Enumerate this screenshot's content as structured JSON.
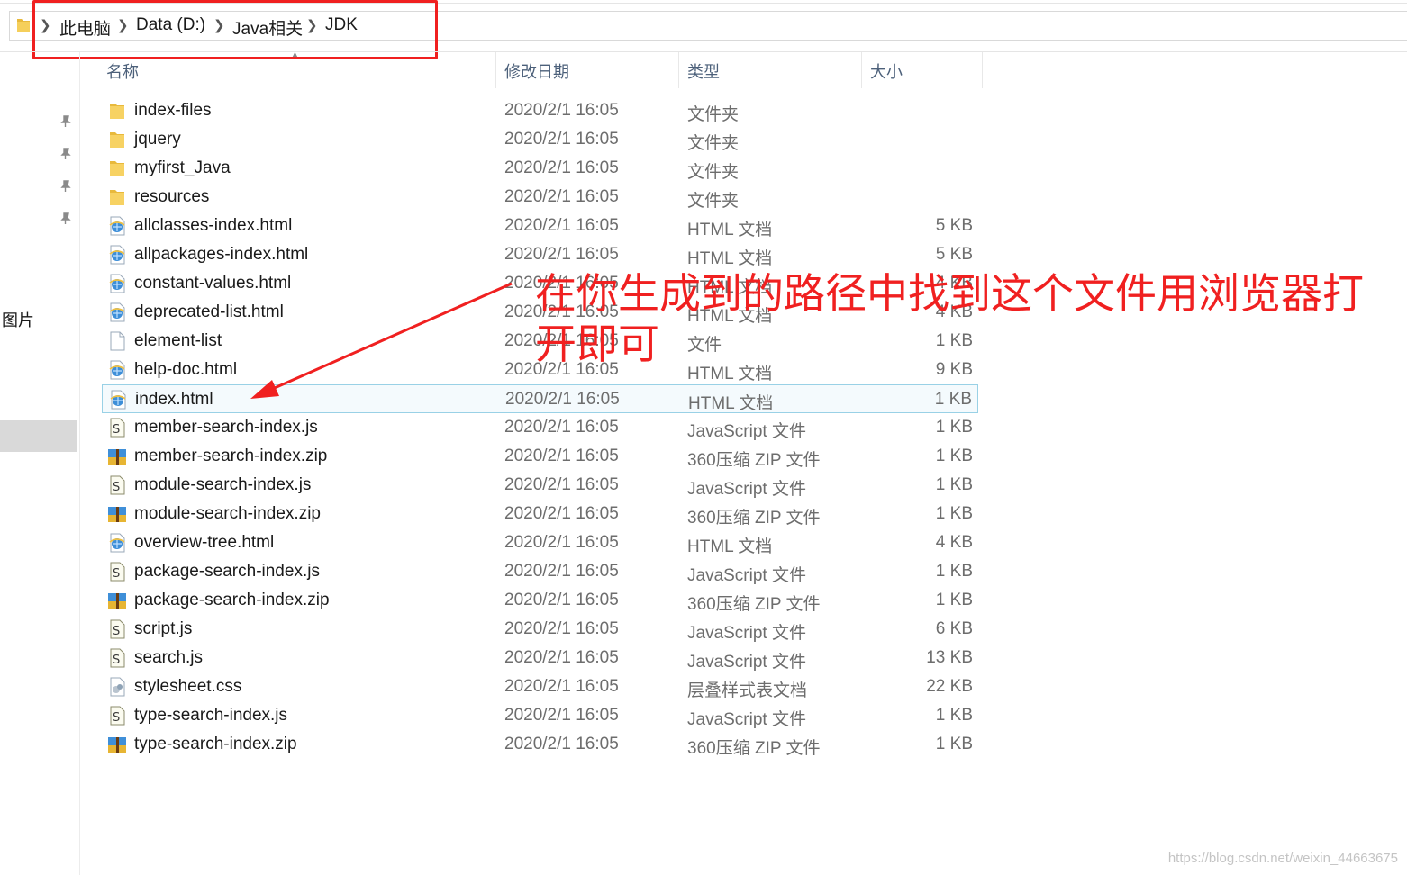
{
  "breadcrumb": [
    "此电脑",
    "Data (D:)",
    "Java相关",
    "JDK"
  ],
  "columns": {
    "name": "名称",
    "date": "修改日期",
    "type": "类型",
    "size": "大小"
  },
  "nav": {
    "label": "图片"
  },
  "files": [
    {
      "name": "index-files",
      "date": "2020/2/1 16:05",
      "type": "文件夹",
      "size": "",
      "icon": "folder-icon"
    },
    {
      "name": "jquery",
      "date": "2020/2/1 16:05",
      "type": "文件夹",
      "size": "",
      "icon": "folder-icon"
    },
    {
      "name": "myfirst_Java",
      "date": "2020/2/1 16:05",
      "type": "文件夹",
      "size": "",
      "icon": "folder-icon"
    },
    {
      "name": "resources",
      "date": "2020/2/1 16:05",
      "type": "文件夹",
      "size": "",
      "icon": "folder-icon"
    },
    {
      "name": "allclasses-index.html",
      "date": "2020/2/1 16:05",
      "type": "HTML 文档",
      "size": "5 KB",
      "icon": "html-file-icon"
    },
    {
      "name": "allpackages-index.html",
      "date": "2020/2/1 16:05",
      "type": "HTML 文档",
      "size": "5 KB",
      "icon": "html-file-icon"
    },
    {
      "name": "constant-values.html",
      "date": "2020/2/1 16:05",
      "type": "HTML 文档",
      "size": "4 KB",
      "icon": "html-file-icon"
    },
    {
      "name": "deprecated-list.html",
      "date": "2020/2/1 16:05",
      "type": "HTML 文档",
      "size": "4 KB",
      "icon": "html-file-icon"
    },
    {
      "name": "element-list",
      "date": "2020/2/1 16:05",
      "type": "文件",
      "size": "1 KB",
      "icon": "blank-file-icon"
    },
    {
      "name": "help-doc.html",
      "date": "2020/2/1 16:05",
      "type": "HTML 文档",
      "size": "9 KB",
      "icon": "html-file-icon"
    },
    {
      "name": "index.html",
      "date": "2020/2/1 16:05",
      "type": "HTML 文档",
      "size": "1 KB",
      "icon": "html-file-icon",
      "selected": true
    },
    {
      "name": "member-search-index.js",
      "date": "2020/2/1 16:05",
      "type": "JavaScript 文件",
      "size": "1 KB",
      "icon": "js-file-icon"
    },
    {
      "name": "member-search-index.zip",
      "date": "2020/2/1 16:05",
      "type": "360压缩 ZIP 文件",
      "size": "1 KB",
      "icon": "zip-file-icon"
    },
    {
      "name": "module-search-index.js",
      "date": "2020/2/1 16:05",
      "type": "JavaScript 文件",
      "size": "1 KB",
      "icon": "js-file-icon"
    },
    {
      "name": "module-search-index.zip",
      "date": "2020/2/1 16:05",
      "type": "360压缩 ZIP 文件",
      "size": "1 KB",
      "icon": "zip-file-icon"
    },
    {
      "name": "overview-tree.html",
      "date": "2020/2/1 16:05",
      "type": "HTML 文档",
      "size": "4 KB",
      "icon": "html-file-icon"
    },
    {
      "name": "package-search-index.js",
      "date": "2020/2/1 16:05",
      "type": "JavaScript 文件",
      "size": "1 KB",
      "icon": "js-file-icon"
    },
    {
      "name": "package-search-index.zip",
      "date": "2020/2/1 16:05",
      "type": "360压缩 ZIP 文件",
      "size": "1 KB",
      "icon": "zip-file-icon"
    },
    {
      "name": "script.js",
      "date": "2020/2/1 16:05",
      "type": "JavaScript 文件",
      "size": "6 KB",
      "icon": "js-file-icon"
    },
    {
      "name": "search.js",
      "date": "2020/2/1 16:05",
      "type": "JavaScript 文件",
      "size": "13 KB",
      "icon": "js-file-icon"
    },
    {
      "name": "stylesheet.css",
      "date": "2020/2/1 16:05",
      "type": "层叠样式表文档",
      "size": "22 KB",
      "icon": "css-file-icon"
    },
    {
      "name": "type-search-index.js",
      "date": "2020/2/1 16:05",
      "type": "JavaScript 文件",
      "size": "1 KB",
      "icon": "js-file-icon"
    },
    {
      "name": "type-search-index.zip",
      "date": "2020/2/1 16:05",
      "type": "360压缩 ZIP 文件",
      "size": "1 KB",
      "icon": "zip-file-icon"
    }
  ],
  "annotation": {
    "text": "在你生成到的路径中找到这个文件用浏览器打开即可",
    "color": "#f02020"
  },
  "watermark": "https://blog.csdn.net/weixin_44663675",
  "colors": {
    "selection_border": "#99d1e6",
    "highlight": "#f02020",
    "header_text": "#4c607a"
  }
}
